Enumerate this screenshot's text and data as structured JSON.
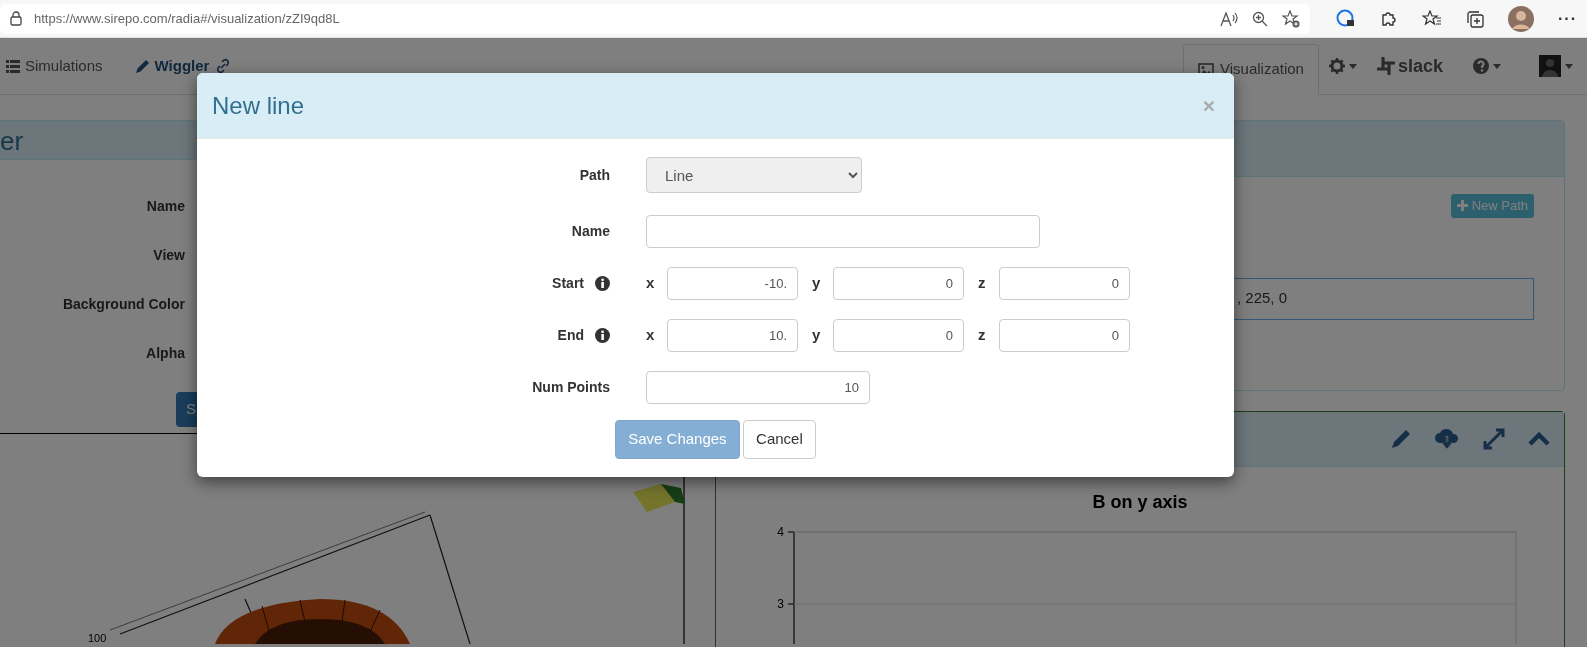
{
  "browser": {
    "url": "https://www.sirepo.com/radia#/visualization/zZI9qd8L",
    "more": "···"
  },
  "navbar": {
    "items": [
      {
        "label": "Simulations",
        "kind": "list"
      },
      {
        "label": "Wiggler",
        "kind": "edit"
      }
    ],
    "tabs": [
      {
        "label": "Visualization",
        "selected": true
      }
    ],
    "slack": "slack"
  },
  "left_panel": {
    "title": "er",
    "fields": [
      "Name",
      "View",
      "Background Color",
      "Alpha"
    ],
    "button": "S",
    "axis_label": "100"
  },
  "path_panel": {
    "button": "New Path",
    "color_value": ", 225, 0"
  },
  "plot_panel": {
    "title": "B on y axis",
    "tick_labels": [
      "4",
      "3"
    ]
  },
  "modal": {
    "title": "New line",
    "close": "×",
    "path": {
      "label": "Path",
      "value": "Line"
    },
    "name_label": "Name",
    "vectors": [
      {
        "label": "Start",
        "coords": [
          {
            "axis": "x",
            "value": "-10."
          },
          {
            "axis": "y",
            "value": "0"
          },
          {
            "axis": "z",
            "value": "0"
          }
        ]
      },
      {
        "label": "End",
        "coords": [
          {
            "axis": "x",
            "value": "10."
          },
          {
            "axis": "y",
            "value": "0"
          },
          {
            "axis": "z",
            "value": "0"
          }
        ]
      }
    ],
    "num_points": {
      "label": "Num Points",
      "value": "10"
    },
    "buttons": [
      {
        "label": "Save Changes",
        "kind": "primary",
        "disabled": true
      },
      {
        "label": "Cancel",
        "kind": "default",
        "disabled": false
      }
    ]
  }
}
